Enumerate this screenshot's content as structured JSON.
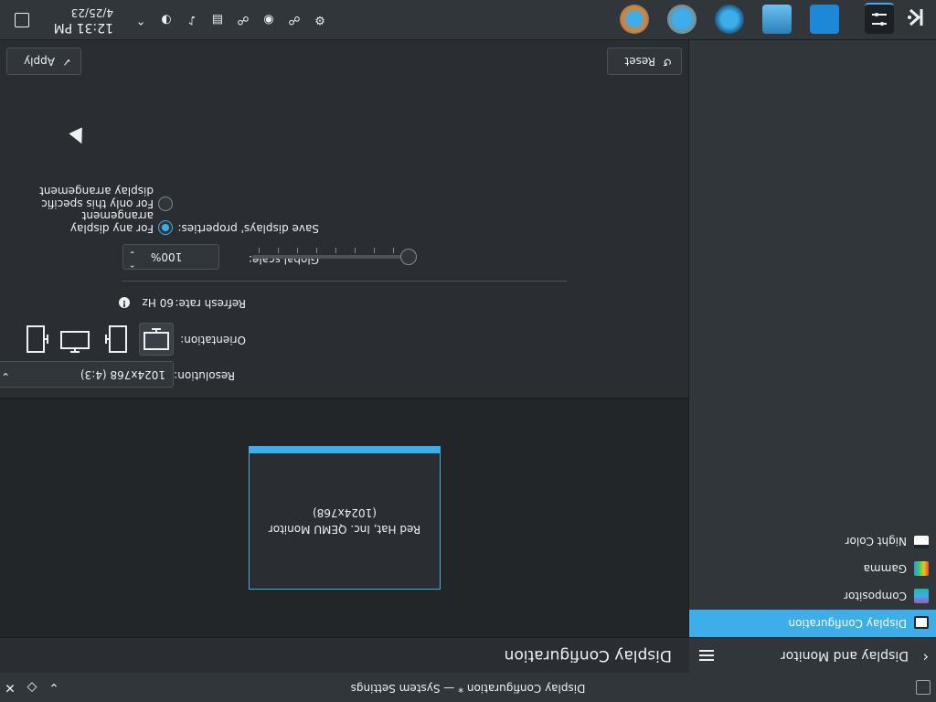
{
  "window": {
    "title": "Display Configuration * — System Settings",
    "buttons": [
      "close-button",
      "pin-button",
      "minimize-button"
    ]
  },
  "header": {
    "breadcrumb": "Display and Monitor",
    "page_title": "Display Configuration"
  },
  "sidebar": {
    "items": [
      {
        "label": "Display Configuration",
        "icon": "display-icon",
        "active": true
      },
      {
        "label": "Compositor",
        "icon": "compositor-icon",
        "active": false
      },
      {
        "label": "Gamma",
        "icon": "gamma-icon",
        "active": false
      },
      {
        "label": "Night Color",
        "icon": "night-color-icon",
        "active": false
      }
    ]
  },
  "monitor": {
    "name": "Red Hat, Inc. QEMU Monitor",
    "resolution_label": "(1024x768)"
  },
  "settings": {
    "resolution": {
      "label": "Resolution:",
      "value": "1024x768 (4:3)"
    },
    "orientation": {
      "label": "Orientation:",
      "options": [
        "landscape",
        "portrait-left",
        "landscape-flipped",
        "portrait-right"
      ],
      "selected": 0
    },
    "refresh": {
      "label": "Refresh rate:",
      "value": "60 Hz"
    },
    "scale": {
      "label": "Global scale:",
      "value": "100%",
      "slider_position": 0
    },
    "save": {
      "label": "Save displays' properties:",
      "options": [
        "For any display arrangement",
        "For only this specific display arrangement"
      ],
      "selected": 0
    }
  },
  "actions": {
    "reset": "Reset",
    "apply": "Apply"
  },
  "taskbar": {
    "time": "12:31 PM",
    "date": "4/25/23",
    "launchers": [
      "app-launcher-icon",
      "system-settings-icon",
      "file-manager-icon",
      "desktop-icon",
      "discover-icon",
      "settings-icon",
      "browser-icon"
    ],
    "tray": [
      "updates-icon",
      "network-icon",
      "vault-icon",
      "clipboard-icon",
      "volume-icon",
      "keyboard-icon",
      "expand-icon"
    ]
  },
  "colors": {
    "accent": "#3daee9",
    "background": "#2a2e32",
    "panel": "#31363b"
  }
}
